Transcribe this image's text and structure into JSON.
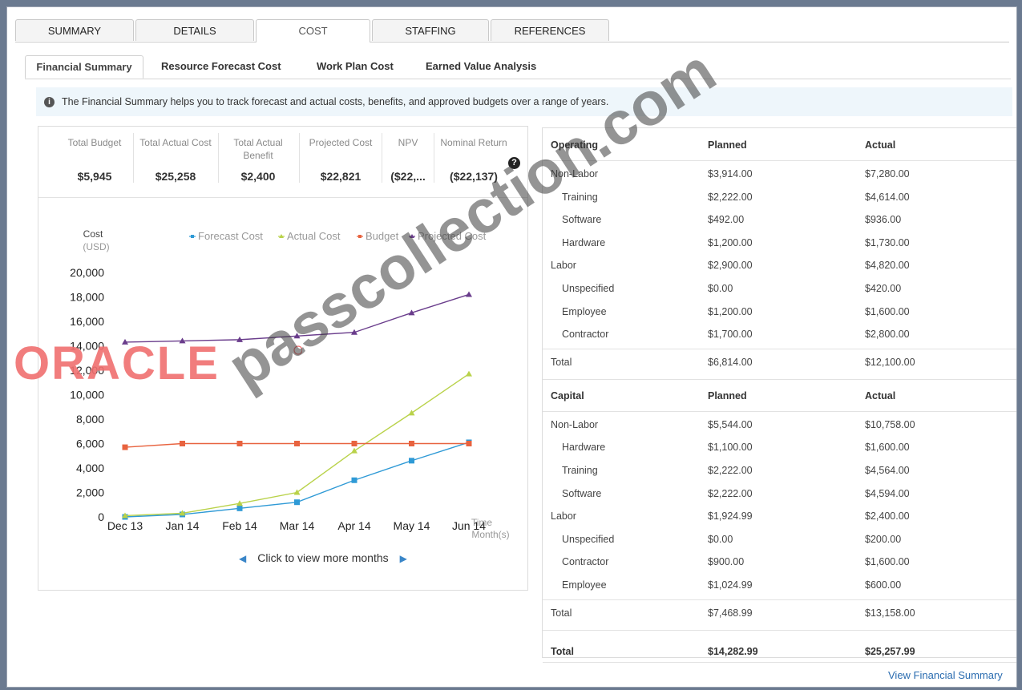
{
  "main_tabs": [
    "SUMMARY",
    "DETAILS",
    "COST",
    "STAFFING",
    "REFERENCES"
  ],
  "main_tab_active": "COST",
  "sub_tabs": [
    "Financial Summary",
    "Resource Forecast Cost",
    "Work Plan Cost",
    "Earned Value Analysis"
  ],
  "sub_tab_active": "Financial Summary",
  "info": {
    "icon": "info-icon",
    "text": "The Financial Summary helps you to track forecast and actual costs, benefits, and approved budgets over a range of years."
  },
  "metrics": [
    {
      "label": "Total Budget",
      "value": "$5,945"
    },
    {
      "label": "Total Actual Cost",
      "value": "$25,258"
    },
    {
      "label": "Total Actual\nBenefit",
      "value": "$2,400"
    },
    {
      "label": "Projected Cost",
      "value": "$22,821"
    },
    {
      "label": "NPV",
      "value": "($22,..."
    },
    {
      "label": "Nominal Return",
      "value": "($22,137)"
    }
  ],
  "help_icon": "?",
  "chart_data": {
    "type": "line",
    "ylabel": "Cost",
    "yunit": "(USD)",
    "xlabel": "Time",
    "xunit": "Month(s)",
    "categories": [
      "Dec 13",
      "Jan 14",
      "Feb 14",
      "Mar 14",
      "Apr 14",
      "May 14",
      "Jun 14"
    ],
    "ylim": [
      0,
      20000
    ],
    "yticks": [
      "0",
      "2,000",
      "4,000",
      "6,000",
      "8,000",
      "10,000",
      "12,000",
      "14,000",
      "16,000",
      "18,000",
      "20,000"
    ],
    "grid": false,
    "legend_position": "top",
    "series": [
      {
        "name": "Forecast Cost",
        "color": "#2f9ad6",
        "marker": "square",
        "values": [
          0,
          200,
          700,
          1200,
          3000,
          4600,
          6100
        ]
      },
      {
        "name": "Actual Cost",
        "color": "#b9d24a",
        "marker": "triangle",
        "values": [
          100,
          300,
          1100,
          2000,
          5400,
          8500,
          11700
        ]
      },
      {
        "name": "Budget",
        "color": "#e8633f",
        "marker": "square",
        "values": [
          5700,
          6000,
          6000,
          6000,
          6000,
          6000,
          6000
        ]
      },
      {
        "name": "Projected Cost",
        "color": "#6a3d8c",
        "marker": "triangle",
        "values": [
          14300,
          14400,
          14500,
          14800,
          15100,
          16700,
          18200
        ]
      }
    ]
  },
  "more_months": {
    "label": "Click to view more months",
    "prev_icon": "chevron-left-icon",
    "next_icon": "chevron-right-icon"
  },
  "operating": {
    "headers": [
      "Operating",
      "Planned",
      "Actual"
    ],
    "rows": [
      {
        "label": "Non-Labor",
        "indent": false,
        "planned": "$3,914.00",
        "actual": "$7,280.00"
      },
      {
        "label": "Training",
        "indent": true,
        "planned": "$2,222.00",
        "actual": "$4,614.00"
      },
      {
        "label": "Software",
        "indent": true,
        "planned": "$492.00",
        "actual": "$936.00"
      },
      {
        "label": "Hardware",
        "indent": true,
        "planned": "$1,200.00",
        "actual": "$1,730.00"
      },
      {
        "label": "Labor",
        "indent": false,
        "planned": "$2,900.00",
        "actual": "$4,820.00"
      },
      {
        "label": "Unspecified",
        "indent": true,
        "planned": "$0.00",
        "actual": "$420.00"
      },
      {
        "label": "Employee",
        "indent": true,
        "planned": "$1,200.00",
        "actual": "$1,600.00"
      },
      {
        "label": "Contractor",
        "indent": true,
        "planned": "$1,700.00",
        "actual": "$2,800.00"
      }
    ],
    "total": {
      "label": "Total",
      "planned": "$6,814.00",
      "actual": "$12,100.00"
    }
  },
  "capital": {
    "headers": [
      "Capital",
      "Planned",
      "Actual"
    ],
    "rows": [
      {
        "label": "Non-Labor",
        "indent": false,
        "planned": "$5,544.00",
        "actual": "$10,758.00"
      },
      {
        "label": "Hardware",
        "indent": true,
        "planned": "$1,100.00",
        "actual": "$1,600.00"
      },
      {
        "label": "Training",
        "indent": true,
        "planned": "$2,222.00",
        "actual": "$4,564.00"
      },
      {
        "label": "Software",
        "indent": true,
        "planned": "$2,222.00",
        "actual": "$4,594.00"
      },
      {
        "label": "Labor",
        "indent": false,
        "planned": "$1,924.99",
        "actual": "$2,400.00"
      },
      {
        "label": "Unspecified",
        "indent": true,
        "planned": "$0.00",
        "actual": "$200.00"
      },
      {
        "label": "Contractor",
        "indent": true,
        "planned": "$900.00",
        "actual": "$1,600.00"
      },
      {
        "label": "Employee",
        "indent": true,
        "planned": "$1,024.99",
        "actual": "$600.00"
      }
    ],
    "total": {
      "label": "Total",
      "planned": "$7,468.99",
      "actual": "$13,158.00"
    }
  },
  "grand_total": {
    "label": "Total",
    "planned": "$14,282.99",
    "actual": "$25,257.99"
  },
  "view_link": "View Financial Summary",
  "watermark": "passcollection.com",
  "logo": {
    "text": "ORACLE",
    "color": "#f07070"
  }
}
